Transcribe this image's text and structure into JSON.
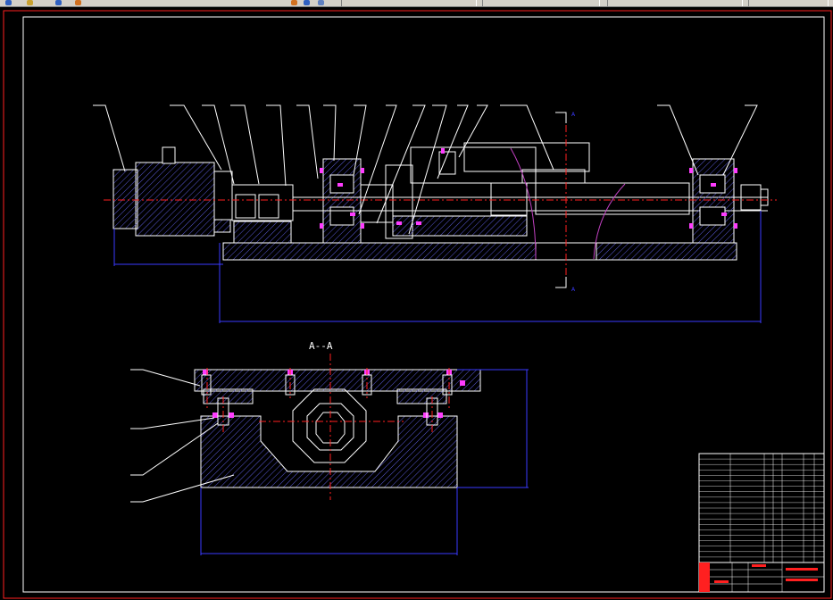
{
  "toolbar": {
    "title_text": "",
    "right_label": "",
    "colors": {
      "face": "#d4d0c8",
      "shadow": "#808080"
    }
  },
  "drawing": {
    "section_label": "A--A",
    "section_mark_top": "A",
    "section_mark_bottom": "A",
    "colors": {
      "background": "#000000",
      "border": "#ff2020",
      "outline": "#ffffff",
      "dimension": "#3a3aff",
      "center": "#ff2020",
      "hatch": "#5a5ad8",
      "fastener": "#ff3cff",
      "arc": "#c040c0"
    }
  },
  "technical_notes": {
    "title": "",
    "lines": [
      "",
      "",
      ""
    ]
  },
  "title_block": {
    "drawing_title": ""
  }
}
